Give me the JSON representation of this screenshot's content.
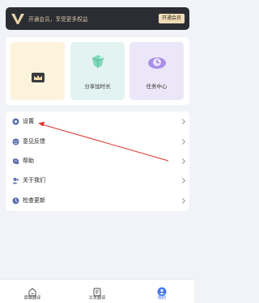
{
  "vip": {
    "logo_icon": "vip-v-logo-icon",
    "text": "开通会员，享受更多权益",
    "button_label": "开通会员",
    "colors": {
      "background": "#2c2d33",
      "accent": "#eedcb8"
    }
  },
  "cards": [
    {
      "label": "",
      "icon": "crown-card-icon",
      "color": "#fbf3dc"
    },
    {
      "label": "分享加时长",
      "icon": "share-gem-icon",
      "color": "#e3f3f1"
    },
    {
      "label": "任务中心",
      "icon": "task-clock-icon",
      "color": "#ece7f8"
    }
  ],
  "menu": {
    "items": [
      {
        "label": "设置",
        "icon": "settings-icon"
      },
      {
        "label": "意见反馈",
        "icon": "feedback-icon"
      },
      {
        "label": "帮助",
        "icon": "help-icon"
      },
      {
        "label": "关于我们",
        "icon": "about-us-icon"
      },
      {
        "label": "检查更新",
        "icon": "check-update-icon"
      }
    ]
  },
  "tabbar": {
    "items": [
      {
        "label": "屏幕翻译",
        "icon": "screen-translate-icon",
        "active": false
      },
      {
        "label": "文本翻译",
        "icon": "text-translate-icon",
        "active": false
      },
      {
        "label": "我的",
        "icon": "profile-icon",
        "active": true
      }
    ],
    "active_color": "#4a7bf0"
  },
  "annotation": {
    "color": "#e0322c"
  }
}
